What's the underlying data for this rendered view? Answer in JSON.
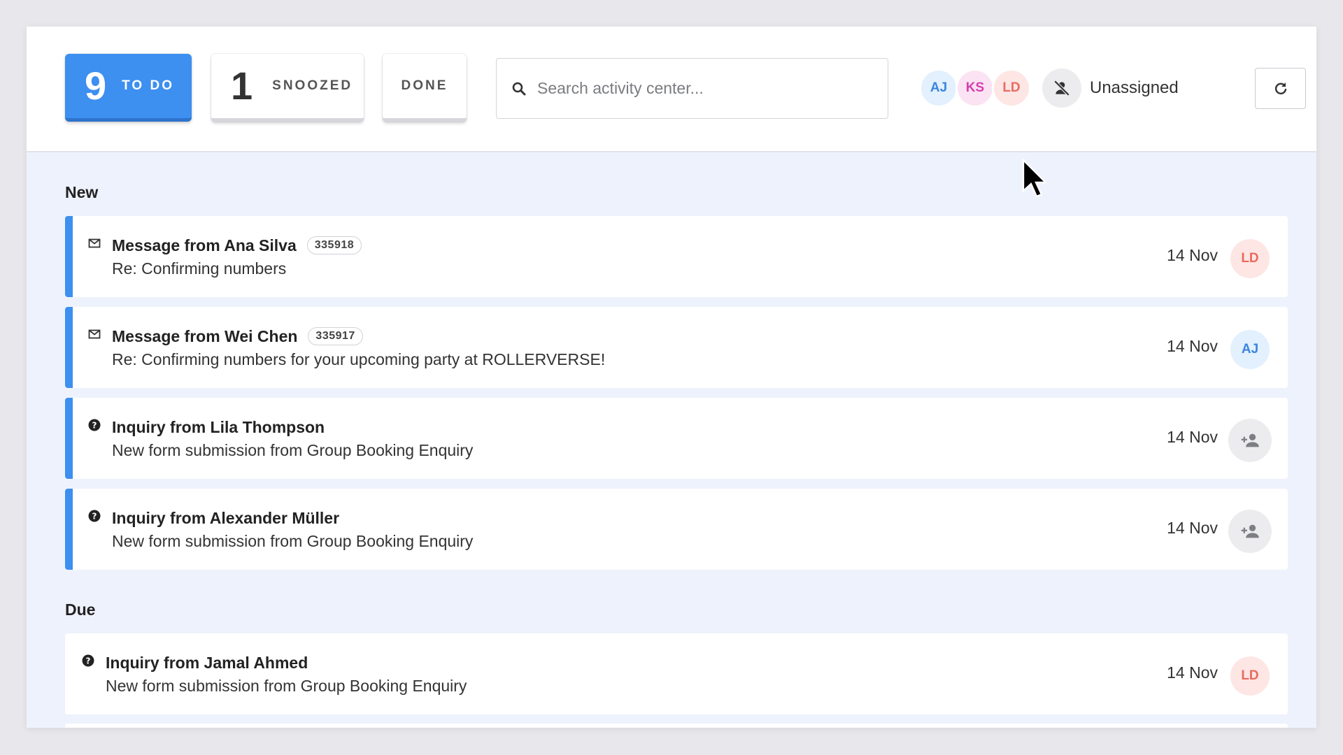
{
  "tabs": {
    "todo": {
      "count": "9",
      "label": "TO DO"
    },
    "snoozed": {
      "count": "1",
      "label": "SNOOZED"
    },
    "done": {
      "label": "DONE"
    }
  },
  "search": {
    "placeholder": "Search activity center...",
    "value": ""
  },
  "filters": {
    "avatars": [
      {
        "initials": "AJ",
        "color": "#3a86de"
      },
      {
        "initials": "KS",
        "color": "#d63fb0"
      },
      {
        "initials": "LD",
        "color": "#ea6a5f"
      }
    ],
    "unassigned_label": "Unassigned",
    "unassigned_icon": "person-off-icon"
  },
  "refresh_icon": "refresh-icon",
  "accent_color": "#3d8ff0",
  "sections": {
    "new": {
      "heading": "New",
      "items": [
        {
          "icon": "mail-icon",
          "title": "Message from Ana Silva",
          "ref": "335918",
          "subtitle": "Re: Confirming numbers",
          "date": "14 Nov",
          "assignee": "LD"
        },
        {
          "icon": "mail-icon",
          "title": "Message from Wei Chen",
          "ref": "335917",
          "subtitle": "Re: Confirming numbers for your upcoming party at ROLLERVERSE!",
          "date": "14 Nov",
          "assignee": "AJ"
        },
        {
          "icon": "question-icon",
          "title": "Inquiry from Lila Thompson",
          "subtitle": "New form submission from Group Booking Enquiry",
          "date": "14 Nov",
          "assignee_icon": "add-person-icon"
        },
        {
          "icon": "question-icon",
          "title": "Inquiry from Alexander Müller",
          "subtitle": "New form submission from Group Booking Enquiry",
          "date": "14 Nov",
          "assignee_icon": "add-person-icon"
        }
      ]
    },
    "due": {
      "heading": "Due",
      "items": [
        {
          "icon": "question-icon",
          "title": "Inquiry from Jamal Ahmed",
          "subtitle": "New form submission from Group Booking Enquiry",
          "date": "14 Nov",
          "assignee": "LD"
        }
      ]
    }
  }
}
